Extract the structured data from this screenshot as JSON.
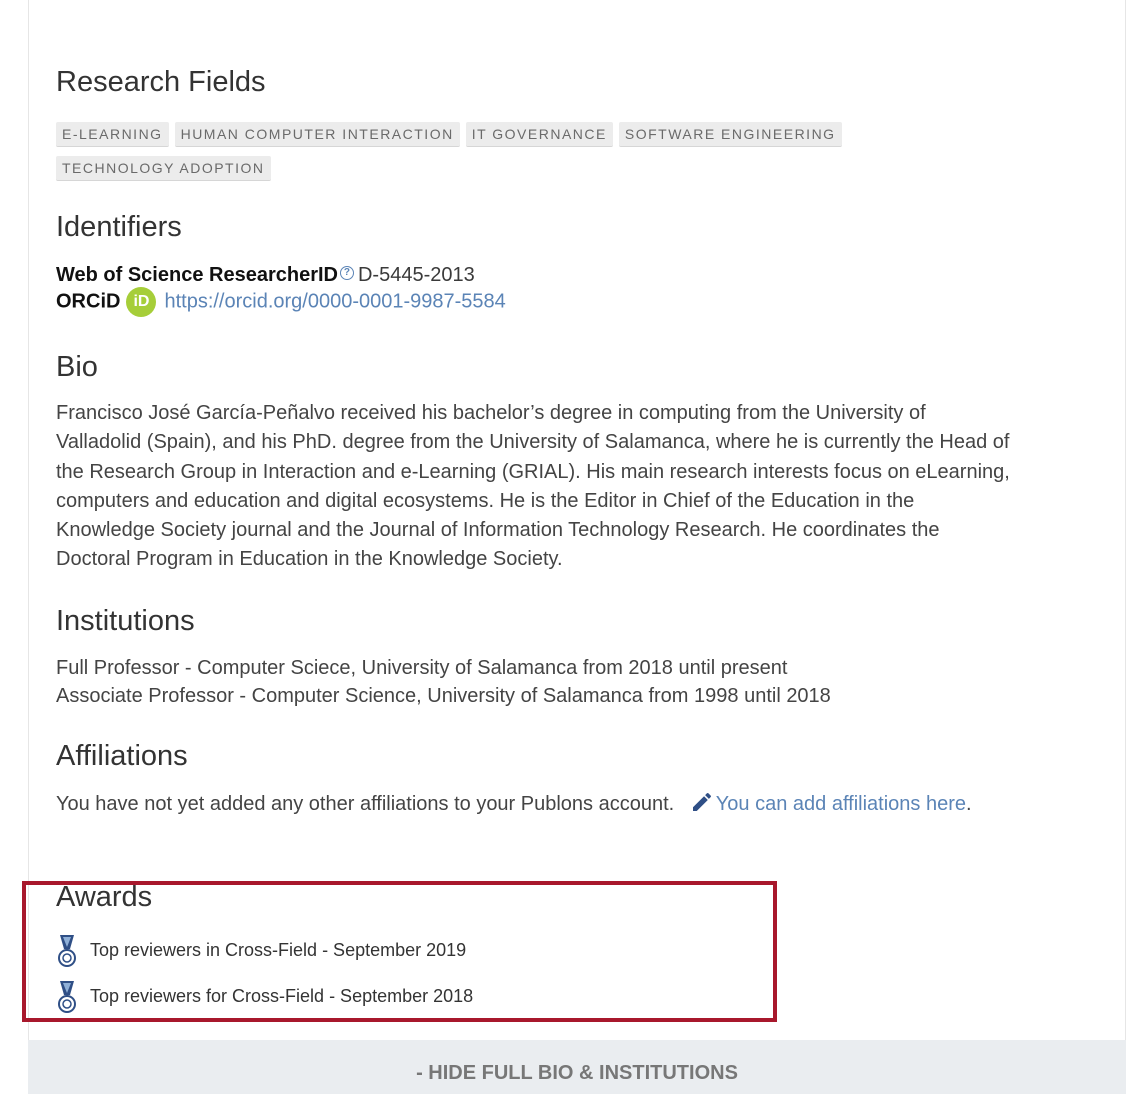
{
  "research_fields": {
    "heading": "Research Fields",
    "tags": [
      "E-LEARNING",
      "HUMAN COMPUTER INTERACTION",
      "IT GOVERNANCE",
      "SOFTWARE ENGINEERING",
      "TECHNOLOGY ADOPTION"
    ]
  },
  "identifiers": {
    "heading": "Identifiers",
    "wos_label": "Web of Science ResearcherID",
    "wos_value": "D-5445-2013",
    "orcid_label": "ORCiD",
    "orcid_logo_text": "iD",
    "orcid_url": "https://orcid.org/0000-0001-9987-5584"
  },
  "bio": {
    "heading": "Bio",
    "text": "Francisco José García-Peñalvo received his bachelor’s degree in computing from the University of Valladolid (Spain), and his PhD. degree from the University of Salamanca, where he is currently the Head of the Research Group in Interaction and e-Learning (GRIAL). His main research interests focus on eLearning, computers and education and digital ecosystems. He is the Editor in Chief of the Education in the Knowledge Society journal and the Journal of Information Technology Research. He coordinates the Doctoral Program in Education in the Knowledge Society."
  },
  "institutions": {
    "heading": "Institutions",
    "items": [
      "Full Professor - Computer Sciece, University of Salamanca from 2018 until present",
      "Associate Professor - Computer Science, University of Salamanca from 1998 until 2018"
    ]
  },
  "affiliations": {
    "heading": "Affiliations",
    "text": "You have not yet added any other affiliations to your Publons account.",
    "link_text": "You can add affiliations here",
    "trailing": ".",
    "icon": "pencil-icon"
  },
  "awards": {
    "heading": "Awards",
    "items": [
      "Top reviewers in Cross-Field - September 2019",
      "Top reviewers for Cross-Field - September 2018"
    ],
    "icon": "medal-icon"
  },
  "footer": {
    "toggle_label": "- HIDE FULL BIO & INSTITUTIONS"
  },
  "colors": {
    "link": "#5b84b6",
    "highlight": "#a8182c",
    "orcid": "#a6ce39"
  }
}
